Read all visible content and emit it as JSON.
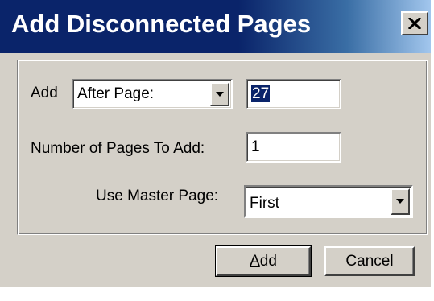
{
  "dialog": {
    "title": "Add Disconnected Pages",
    "close_icon": "close-icon"
  },
  "form": {
    "add_label": "Add",
    "position_select": {
      "value": "After Page:",
      "icon": "chevron-down-icon"
    },
    "page_number": {
      "value": "27",
      "selected": true
    },
    "count_label": "Number of Pages To Add:",
    "count_value": "1",
    "master_label": "Use Master Page:",
    "master_select": {
      "value": "First",
      "icon": "chevron-down-icon"
    }
  },
  "buttons": {
    "add_label": "Add",
    "cancel_label": "Cancel"
  },
  "colors": {
    "titlebar": "#0a246a",
    "face": "#d4d0c8",
    "selection": "#0a246a"
  }
}
